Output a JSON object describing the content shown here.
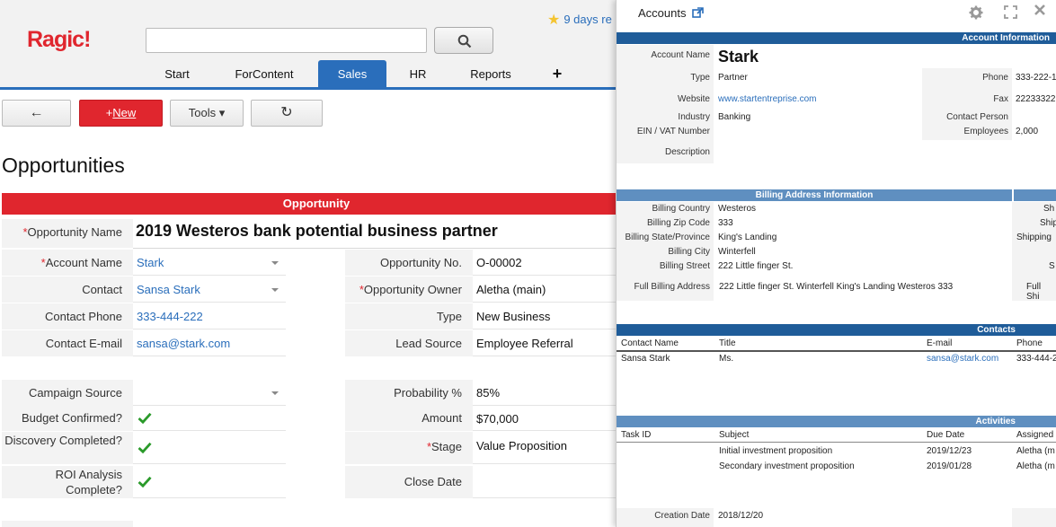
{
  "header": {
    "logo": "Ragic!",
    "search_placeholder": "",
    "notification": "9 days re",
    "tabs": [
      "Start",
      "ForContent",
      "Sales",
      "HR",
      "Reports",
      "+"
    ]
  },
  "toolbar": {
    "back": "←",
    "new_prefix": "+",
    "new_label": "New",
    "tools": "Tools ▾",
    "refresh": "↻"
  },
  "page": {
    "title": "Opportunities",
    "section": "Opportunity",
    "opportunity_name_label": "Opportunity Name",
    "opportunity_name": "2019 Westeros bank potential business partner",
    "left_fields": [
      {
        "label": "Account Name",
        "value": "Stark",
        "required": true
      },
      {
        "label": "Contact",
        "value": "Sansa Stark",
        "required": false
      },
      {
        "label": "Contact Phone",
        "value": "333-444-222",
        "required": false
      },
      {
        "label": "Contact E-mail",
        "value": "sansa@stark.com",
        "required": false
      },
      {
        "label": "Campaign Source",
        "value": "",
        "required": false
      },
      {
        "label": "Budget Confirmed?",
        "value": "",
        "required": false
      },
      {
        "label": "Discovery Completed?",
        "value": "",
        "required": false
      },
      {
        "label": "ROI Analysis Complete?",
        "value": "",
        "required": false
      }
    ],
    "right_fields": [
      {
        "label": "Opportunity No.",
        "value": "O-00002",
        "required": false
      },
      {
        "label": "Opportunity Owner",
        "value": "Aletha (main)",
        "required": true
      },
      {
        "label": "Type",
        "value": "New Business",
        "required": false
      },
      {
        "label": "Lead Source",
        "value": "Employee Referral",
        "required": false
      },
      {
        "label": "Probability %",
        "value": "85%",
        "required": false
      },
      {
        "label": "Amount",
        "value": "$70,000",
        "required": false
      },
      {
        "label": "Stage",
        "value": "Value Proposition",
        "required": true
      },
      {
        "label": "Close Date",
        "value": "",
        "required": false
      }
    ]
  },
  "overlay": {
    "title": "Accounts",
    "account_info_title": "Account Information",
    "account_name_label": "Account Name",
    "account_name": "Stark",
    "info_left": [
      {
        "label": "Type",
        "value": "Partner"
      },
      {
        "label": "Website",
        "value": "www.startentreprise.com"
      },
      {
        "label": "Industry",
        "value": "Banking"
      },
      {
        "label": "EIN / VAT Number",
        "value": ""
      },
      {
        "label": "Description",
        "value": ""
      }
    ],
    "info_right": [
      {
        "label": "Phone",
        "value": "333-222-1"
      },
      {
        "label": "Fax",
        "value": "22233322"
      },
      {
        "label": "Contact Person",
        "value": ""
      },
      {
        "label": "Employees",
        "value": "2,000"
      }
    ],
    "billing_title": "Billing Address Information",
    "billing": [
      {
        "label": "Billing Country",
        "value": "Westeros"
      },
      {
        "label": "Billing Zip Code",
        "value": "333"
      },
      {
        "label": "Billing State/Province",
        "value": "King's Landing"
      },
      {
        "label": "Billing City",
        "value": "Winterfell"
      },
      {
        "label": "Billing Street",
        "value": "222 Little finger St."
      },
      {
        "label": "Full Billing Address",
        "value": "222 Little finger St. Winterfell King's Landing Westeros 333"
      }
    ],
    "shipping_labels": [
      "Sh",
      "Ship",
      "Shipping",
      "S",
      "Full Shi"
    ],
    "contacts_title": "Contacts",
    "contacts_headers": [
      "Contact Name",
      "Title",
      "E-mail",
      "Phone"
    ],
    "contacts_rows": [
      [
        "Sansa Stark",
        "Ms.",
        "sansa@stark.com",
        "333-444-2"
      ]
    ],
    "activities_title": "Activities",
    "activities_headers": [
      "Task ID",
      "Subject",
      "Due Date",
      "Assigned"
    ],
    "activities_rows": [
      [
        "",
        "Initial investment proposition",
        "2019/12/23",
        "Aletha (m"
      ],
      [
        "",
        "Secondary investment proposition",
        "2019/01/28",
        "Aletha (m"
      ]
    ],
    "creation_date_label": "Creation Date",
    "creation_date": "2018/12/20"
  },
  "colors": {
    "accent_red": "#e0262e",
    "accent_blue": "#2a6ebb",
    "check_green": "#2a9a2a"
  }
}
